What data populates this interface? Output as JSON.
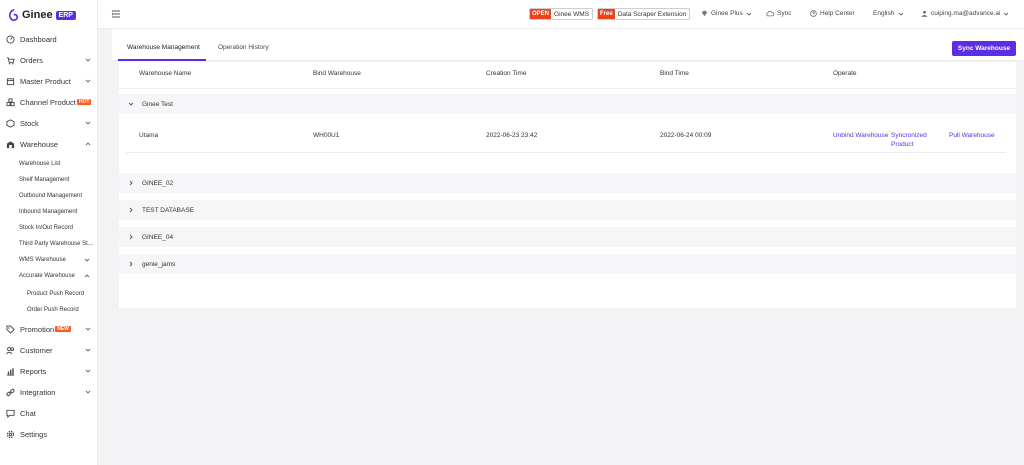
{
  "brand": {
    "name": "Ginee",
    "badge": "ERP",
    "accent": "#5b2ee5"
  },
  "sidebar": {
    "items": [
      {
        "label": "Dashboard",
        "icon": "dashboard-icon"
      },
      {
        "label": "Orders",
        "icon": "cart-icon"
      },
      {
        "label": "Master Product",
        "icon": "box-icon"
      },
      {
        "label": "Channel Product",
        "icon": "channel-icon",
        "badge": "HOT"
      },
      {
        "label": "Stock",
        "icon": "stock-icon"
      },
      {
        "label": "Warehouse",
        "icon": "warehouse-icon"
      },
      {
        "label": "Promotion",
        "icon": "tag-icon",
        "badge": "NEW"
      },
      {
        "label": "Customer",
        "icon": "users-icon"
      },
      {
        "label": "Reports",
        "icon": "chart-icon"
      },
      {
        "label": "Integration",
        "icon": "link-icon"
      },
      {
        "label": "Chat",
        "icon": "chat-icon"
      },
      {
        "label": "Settings",
        "icon": "gear-icon"
      }
    ],
    "warehouse_sub": [
      "Warehouse List",
      "Shelf Management",
      "Outbound Management",
      "Inbound Management",
      "Stock In/Out Record",
      "Third Party Warehouse St...",
      "WMS Warehouse",
      "Accurate Warehouse"
    ],
    "accurate_sub": [
      "Product Push Record",
      "Order Push Record"
    ]
  },
  "topbar": {
    "wms": {
      "tag": "OPEN",
      "label": "Ginee WMS"
    },
    "scraper": {
      "tag": "Free",
      "label": "Data Scraper Extension"
    },
    "plus": "Ginee Plus",
    "sync": "Sync",
    "help": "Help Center",
    "language": "English",
    "user": "cuiping.ma@advance.ai"
  },
  "tabs": [
    "Warehouse Management",
    "Operation History"
  ],
  "sync_button": "Sync Warehouse",
  "table": {
    "headers": [
      "Warehouse Name",
      "Bind Warehouse",
      "Creation Time",
      "Bind Time",
      "Operate"
    ],
    "groups": [
      {
        "name": "Ginee Test",
        "expanded": true,
        "rows": [
          {
            "warehouse_name": "Utama",
            "bind_warehouse": "WH00U1",
            "creation_time": "2022-06-23 23:42",
            "bind_time": "2022-06-24 00:09",
            "operations": [
              "Unbind Warehouse",
              "Syncronized",
              "Product",
              "Pull Warehouse"
            ]
          }
        ]
      },
      {
        "name": "GINEE_02",
        "expanded": false
      },
      {
        "name": "TEST DATABASE",
        "expanded": false
      },
      {
        "name": "GINEE_04",
        "expanded": false
      },
      {
        "name": "genie_jams",
        "expanded": false
      }
    ]
  }
}
